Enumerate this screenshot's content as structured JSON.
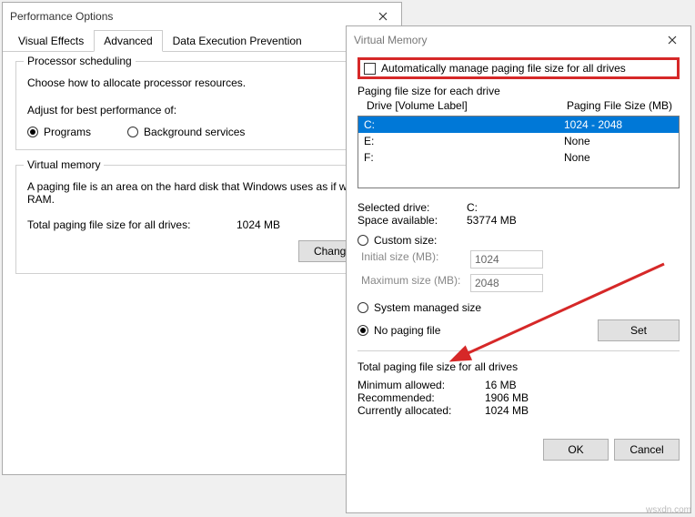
{
  "perf": {
    "title": "Performance Options",
    "tabs": {
      "visual": "Visual Effects",
      "advanced": "Advanced",
      "dep": "Data Execution Prevention"
    },
    "sched": {
      "title": "Processor scheduling",
      "desc": "Choose how to allocate processor resources.",
      "adjust": "Adjust for best performance of:",
      "programs": "Programs",
      "bg": "Background services"
    },
    "vm": {
      "title": "Virtual memory",
      "desc": "A paging file is an area on the hard disk that Windows uses as if were RAM.",
      "total_label": "Total paging file size for all drives:",
      "total_value": "1024 MB",
      "change": "Change..."
    }
  },
  "vmdlg": {
    "title": "Virtual Memory",
    "auto": "Automatically manage paging file size for all drives",
    "list_title": "Paging file size for each drive",
    "col_drive": "Drive  [Volume Label]",
    "col_size": "Paging File Size (MB)",
    "drives": [
      {
        "d": "C:",
        "s": "1024 - 2048",
        "sel": true
      },
      {
        "d": "E:",
        "s": "None",
        "sel": false
      },
      {
        "d": "F:",
        "s": "None",
        "sel": false
      }
    ],
    "selected_drive_label": "Selected drive:",
    "selected_drive": "C:",
    "space_label": "Space available:",
    "space": "53774 MB",
    "custom": "Custom size:",
    "init_label": "Initial size (MB):",
    "init_val": "1024",
    "max_label": "Maximum size (MB):",
    "max_val": "2048",
    "sysman": "System managed size",
    "nopage": "No paging file",
    "set": "Set",
    "totals_title": "Total paging file size for all drives",
    "min_label": "Minimum allowed:",
    "min_val": "16 MB",
    "rec_label": "Recommended:",
    "rec_val": "1906 MB",
    "cur_label": "Currently allocated:",
    "cur_val": "1024 MB",
    "ok": "OK",
    "cancel": "Cancel"
  },
  "watermark": "wsxdn.com"
}
